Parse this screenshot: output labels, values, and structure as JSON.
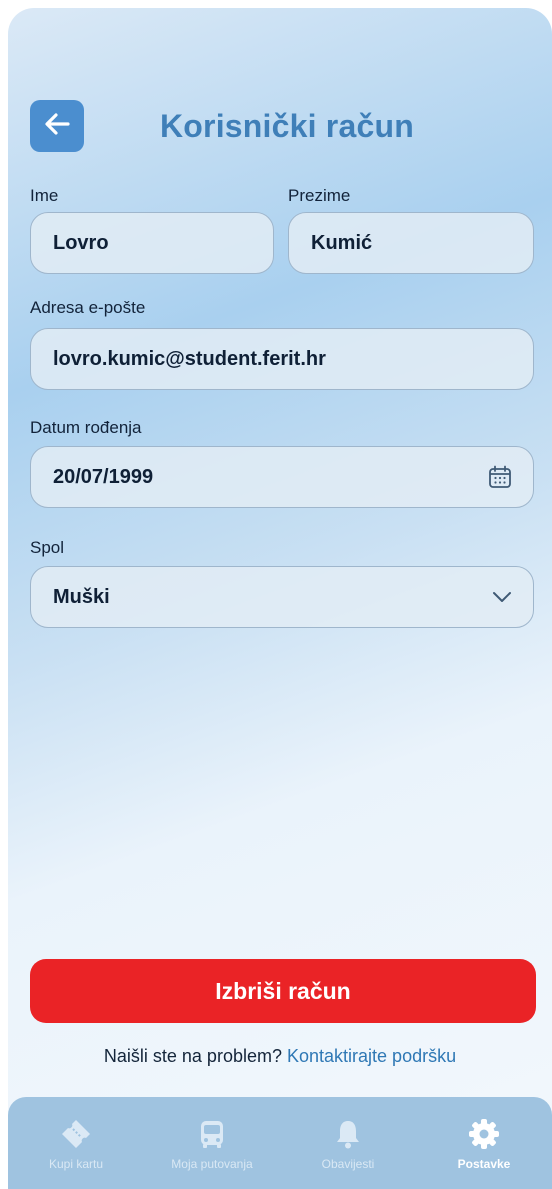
{
  "header": {
    "title": "Korisnički račun",
    "back_icon": "arrow-left-icon"
  },
  "form": {
    "first_name": {
      "label": "Ime",
      "value": "Lovro"
    },
    "last_name": {
      "label": "Prezime",
      "value": "Kumić"
    },
    "email": {
      "label": "Adresa e-pošte",
      "value": "lovro.kumic@student.ferit.hr"
    },
    "birth_date": {
      "label": "Datum rođenja",
      "value": "20/07/1999",
      "icon": "calendar-icon"
    },
    "gender": {
      "label": "Spol",
      "value": "Muški",
      "icon": "chevron-down-icon"
    }
  },
  "actions": {
    "delete_label": "Izbriši račun",
    "help_text": "Naišli ste na problem?",
    "help_link": "Kontaktirajte podršku"
  },
  "tabbar": {
    "items": [
      {
        "label": "Kupi kartu",
        "icon": "ticket-icon",
        "active": false
      },
      {
        "label": "Moja putovanja",
        "icon": "bus-icon",
        "active": false
      },
      {
        "label": "Obavijesti",
        "icon": "bell-icon",
        "active": false
      },
      {
        "label": "Postavke",
        "icon": "gear-icon",
        "active": true
      }
    ]
  },
  "colors": {
    "accent": "#4b8ecf",
    "title": "#3f7fb8",
    "danger": "#ea2326",
    "link": "#2f78b5",
    "tabbar": "#9fc3e0"
  }
}
